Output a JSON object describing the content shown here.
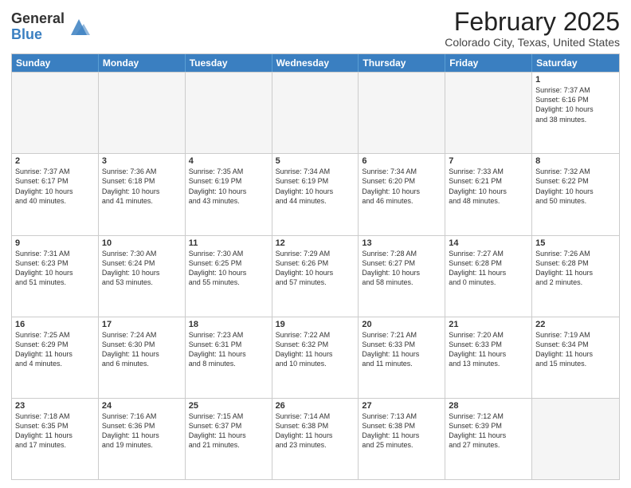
{
  "header": {
    "logo_general": "General",
    "logo_blue": "Blue",
    "month_title": "February 2025",
    "location": "Colorado City, Texas, United States"
  },
  "weekdays": [
    "Sunday",
    "Monday",
    "Tuesday",
    "Wednesday",
    "Thursday",
    "Friday",
    "Saturday"
  ],
  "rows": [
    [
      {
        "day": "",
        "info": ""
      },
      {
        "day": "",
        "info": ""
      },
      {
        "day": "",
        "info": ""
      },
      {
        "day": "",
        "info": ""
      },
      {
        "day": "",
        "info": ""
      },
      {
        "day": "",
        "info": ""
      },
      {
        "day": "1",
        "info": "Sunrise: 7:37 AM\nSunset: 6:16 PM\nDaylight: 10 hours\nand 38 minutes."
      }
    ],
    [
      {
        "day": "2",
        "info": "Sunrise: 7:37 AM\nSunset: 6:17 PM\nDaylight: 10 hours\nand 40 minutes."
      },
      {
        "day": "3",
        "info": "Sunrise: 7:36 AM\nSunset: 6:18 PM\nDaylight: 10 hours\nand 41 minutes."
      },
      {
        "day": "4",
        "info": "Sunrise: 7:35 AM\nSunset: 6:19 PM\nDaylight: 10 hours\nand 43 minutes."
      },
      {
        "day": "5",
        "info": "Sunrise: 7:34 AM\nSunset: 6:19 PM\nDaylight: 10 hours\nand 44 minutes."
      },
      {
        "day": "6",
        "info": "Sunrise: 7:34 AM\nSunset: 6:20 PM\nDaylight: 10 hours\nand 46 minutes."
      },
      {
        "day": "7",
        "info": "Sunrise: 7:33 AM\nSunset: 6:21 PM\nDaylight: 10 hours\nand 48 minutes."
      },
      {
        "day": "8",
        "info": "Sunrise: 7:32 AM\nSunset: 6:22 PM\nDaylight: 10 hours\nand 50 minutes."
      }
    ],
    [
      {
        "day": "9",
        "info": "Sunrise: 7:31 AM\nSunset: 6:23 PM\nDaylight: 10 hours\nand 51 minutes."
      },
      {
        "day": "10",
        "info": "Sunrise: 7:30 AM\nSunset: 6:24 PM\nDaylight: 10 hours\nand 53 minutes."
      },
      {
        "day": "11",
        "info": "Sunrise: 7:30 AM\nSunset: 6:25 PM\nDaylight: 10 hours\nand 55 minutes."
      },
      {
        "day": "12",
        "info": "Sunrise: 7:29 AM\nSunset: 6:26 PM\nDaylight: 10 hours\nand 57 minutes."
      },
      {
        "day": "13",
        "info": "Sunrise: 7:28 AM\nSunset: 6:27 PM\nDaylight: 10 hours\nand 58 minutes."
      },
      {
        "day": "14",
        "info": "Sunrise: 7:27 AM\nSunset: 6:28 PM\nDaylight: 11 hours\nand 0 minutes."
      },
      {
        "day": "15",
        "info": "Sunrise: 7:26 AM\nSunset: 6:28 PM\nDaylight: 11 hours\nand 2 minutes."
      }
    ],
    [
      {
        "day": "16",
        "info": "Sunrise: 7:25 AM\nSunset: 6:29 PM\nDaylight: 11 hours\nand 4 minutes."
      },
      {
        "day": "17",
        "info": "Sunrise: 7:24 AM\nSunset: 6:30 PM\nDaylight: 11 hours\nand 6 minutes."
      },
      {
        "day": "18",
        "info": "Sunrise: 7:23 AM\nSunset: 6:31 PM\nDaylight: 11 hours\nand 8 minutes."
      },
      {
        "day": "19",
        "info": "Sunrise: 7:22 AM\nSunset: 6:32 PM\nDaylight: 11 hours\nand 10 minutes."
      },
      {
        "day": "20",
        "info": "Sunrise: 7:21 AM\nSunset: 6:33 PM\nDaylight: 11 hours\nand 11 minutes."
      },
      {
        "day": "21",
        "info": "Sunrise: 7:20 AM\nSunset: 6:33 PM\nDaylight: 11 hours\nand 13 minutes."
      },
      {
        "day": "22",
        "info": "Sunrise: 7:19 AM\nSunset: 6:34 PM\nDaylight: 11 hours\nand 15 minutes."
      }
    ],
    [
      {
        "day": "23",
        "info": "Sunrise: 7:18 AM\nSunset: 6:35 PM\nDaylight: 11 hours\nand 17 minutes."
      },
      {
        "day": "24",
        "info": "Sunrise: 7:16 AM\nSunset: 6:36 PM\nDaylight: 11 hours\nand 19 minutes."
      },
      {
        "day": "25",
        "info": "Sunrise: 7:15 AM\nSunset: 6:37 PM\nDaylight: 11 hours\nand 21 minutes."
      },
      {
        "day": "26",
        "info": "Sunrise: 7:14 AM\nSunset: 6:38 PM\nDaylight: 11 hours\nand 23 minutes."
      },
      {
        "day": "27",
        "info": "Sunrise: 7:13 AM\nSunset: 6:38 PM\nDaylight: 11 hours\nand 25 minutes."
      },
      {
        "day": "28",
        "info": "Sunrise: 7:12 AM\nSunset: 6:39 PM\nDaylight: 11 hours\nand 27 minutes."
      },
      {
        "day": "",
        "info": ""
      }
    ]
  ]
}
